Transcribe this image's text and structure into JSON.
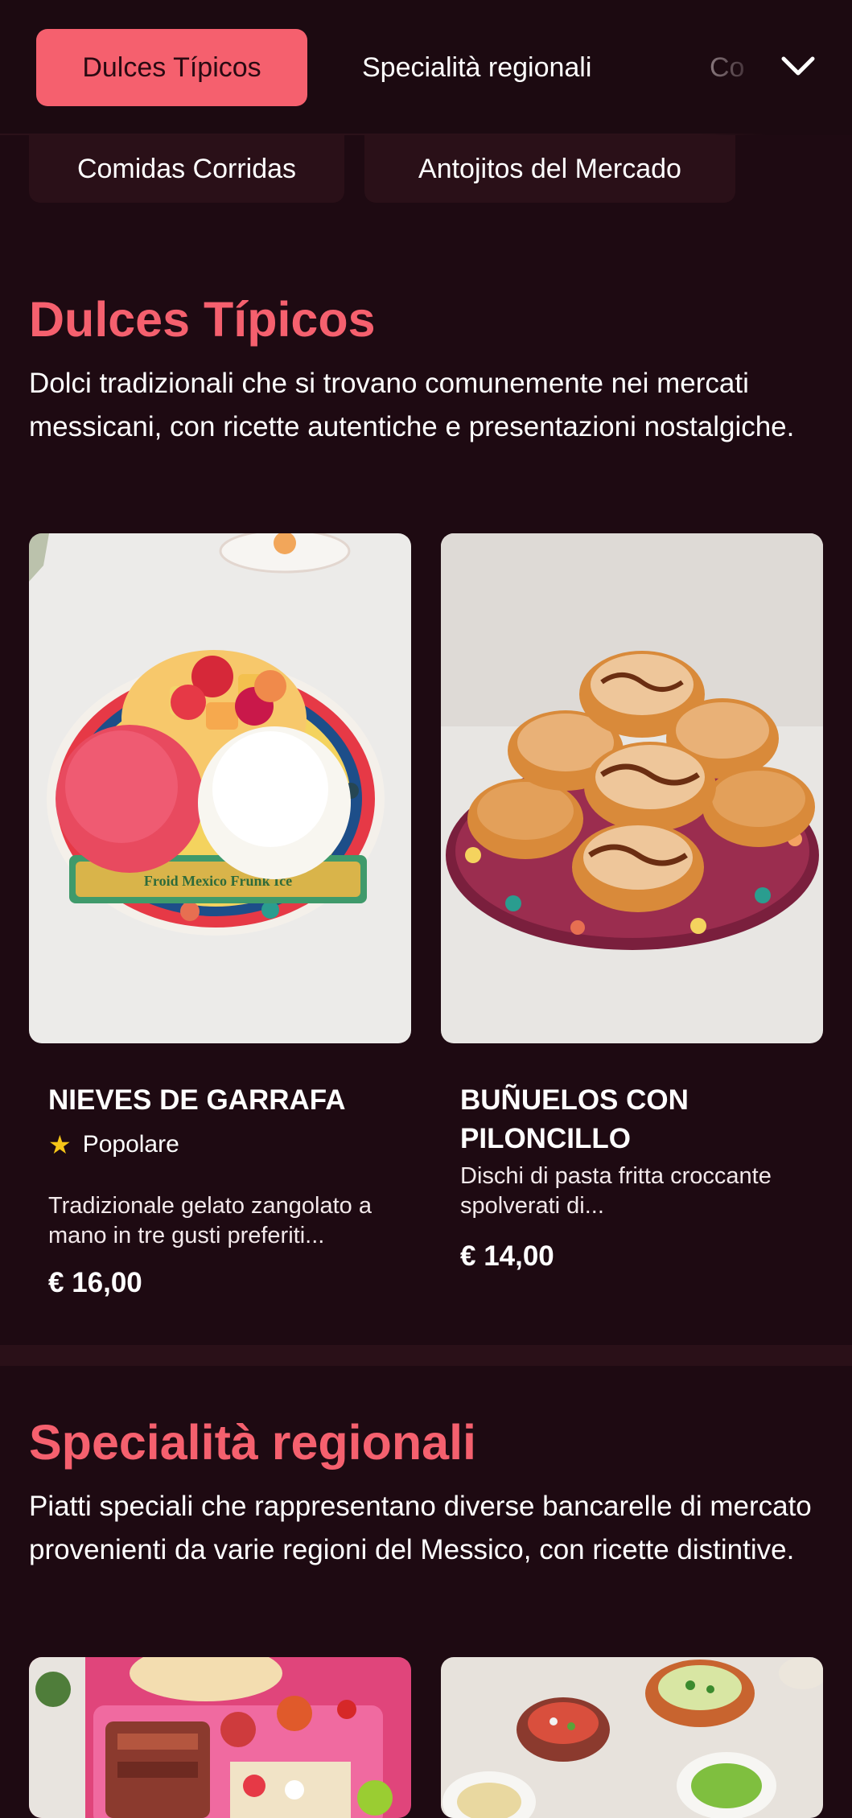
{
  "nav": {
    "tabs": [
      {
        "label": "Dulces Típicos",
        "active": true
      },
      {
        "label": "Specialità regionali",
        "active": false
      },
      {
        "label": "Co",
        "active": false
      }
    ],
    "dropdown_icon": "chevron-down-icon",
    "subtabs": [
      {
        "label": "Comidas Corridas"
      },
      {
        "label": "Antojitos del Mercado"
      }
    ]
  },
  "sections": [
    {
      "title": "Dulces Típicos",
      "description": "Dolci tradizionali che si trovano comunemente nei mercati messicani, con ricette autentiche e presentazioni nostalgiche.",
      "items": [
        {
          "name": "NIEVES DE GARRAFA",
          "badge": "Popolare",
          "badge_icon": "star-icon",
          "description": "Tradizionale gelato zangolato a mano in tre gusti preferiti...",
          "price": "€ 16,00",
          "image_text": "Froid Mexico Frunk Ice"
        },
        {
          "name": "BUÑUELOS CON PILONCILLO",
          "description": "Dischi di pasta fritta croccante spolverati di...",
          "price": "€ 14,00"
        }
      ]
    },
    {
      "title": "Specialità regionali",
      "description": "Piatti speciali che rappresentano diverse bancarelle di mercato provenienti da varie regioni del Messico, con ricette distintive."
    }
  ],
  "colors": {
    "background": "#1e0a12",
    "accent": "#f5606e",
    "chip": "#2a1018",
    "star": "#f5c518"
  }
}
